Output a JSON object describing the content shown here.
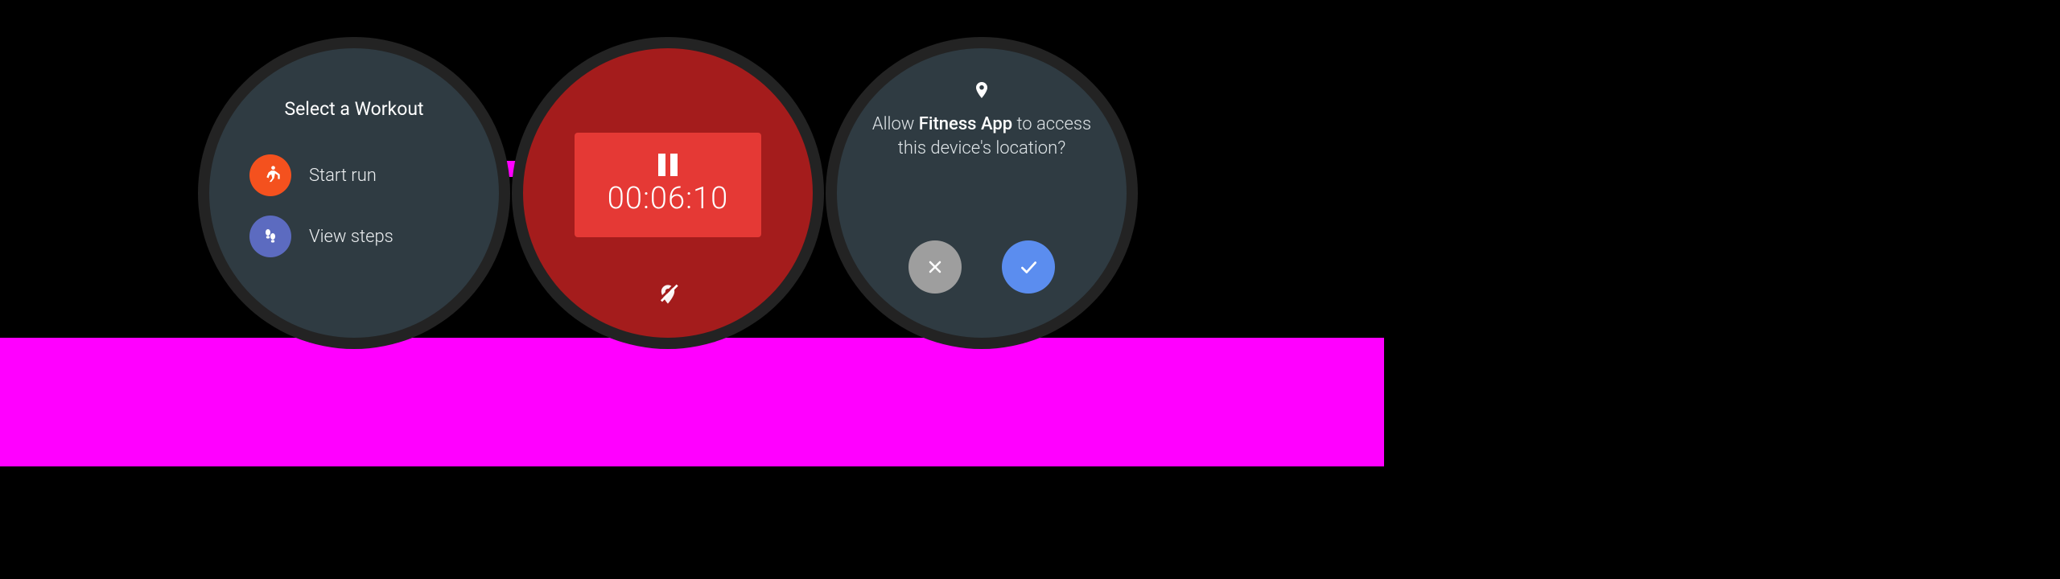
{
  "watch1": {
    "title": "Select a Workout",
    "items": [
      {
        "label": "Start run"
      },
      {
        "label": "View steps"
      }
    ]
  },
  "watch2": {
    "timer": "00:06:10"
  },
  "watch3": {
    "prompt_prefix": "Allow ",
    "app_name": "Fitness App",
    "prompt_suffix": " to access this device's location?"
  },
  "colors": {
    "accent_magenta": "#ff00ff",
    "run_red": "#f4511e",
    "steps_blue": "#5c6bc0",
    "timer_bg": "#a41c1c",
    "timer_card": "#e53935",
    "confirm_blue": "#5b8def",
    "deny_grey": "#9e9e9e"
  }
}
